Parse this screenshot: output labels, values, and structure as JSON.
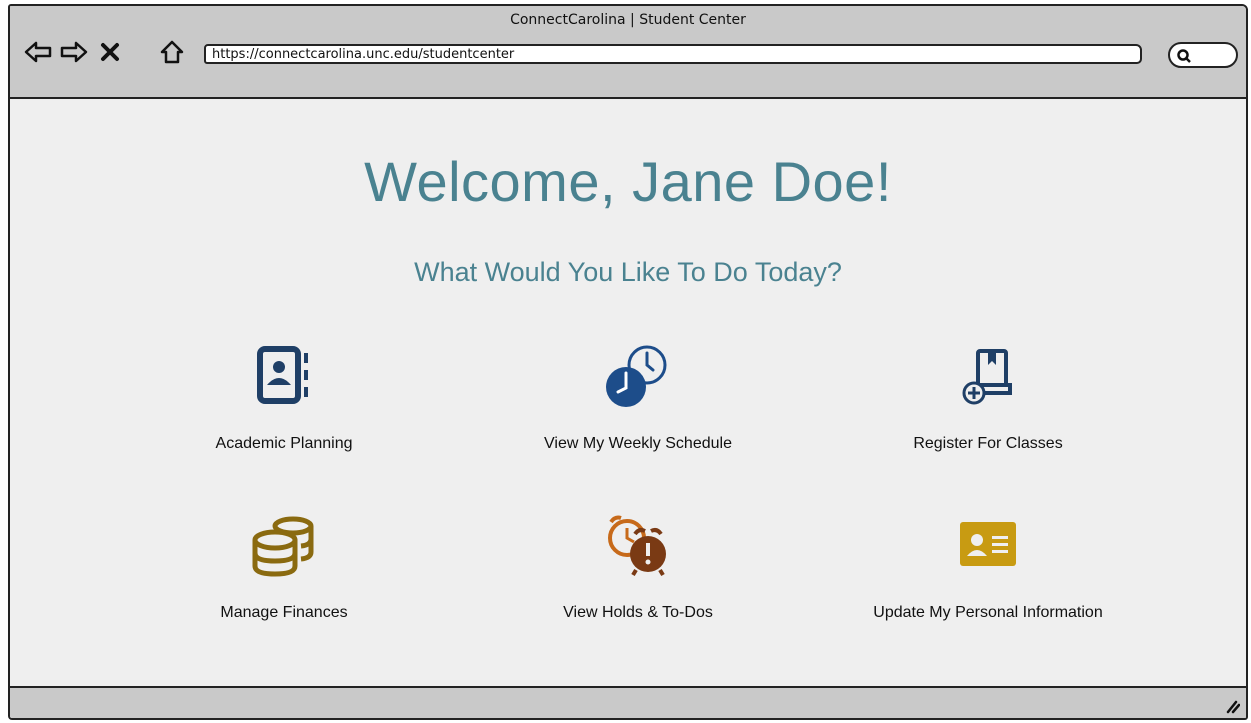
{
  "window": {
    "title": "ConnectCarolina | Student Center"
  },
  "browser": {
    "back_icon": "back-arrow-icon",
    "forward_icon": "forward-arrow-icon",
    "stop_icon": "close-icon",
    "home_icon": "home-icon",
    "url": "https://connectcarolina.unc.edu/studentcenter",
    "search_icon": "search-icon"
  },
  "page": {
    "welcome": "Welcome, Jane Doe!",
    "subtitle": "What Would You Like To Do Today?"
  },
  "actions": [
    {
      "label": "Academic Planning",
      "icon": "address-book-icon",
      "color": "#1f3f66"
    },
    {
      "label": "View My Weekly Schedule",
      "icon": "clock-icon",
      "color": "#1d4d8a"
    },
    {
      "label": "Register For Classes",
      "icon": "book-add-icon",
      "color": "#1f3f66"
    },
    {
      "label": "Manage Finances",
      "icon": "coins-icon",
      "color": "#8a6a10"
    },
    {
      "label": "View Holds & To-Dos",
      "icon": "alarm-alert-icon",
      "color": "#8a3a10"
    },
    {
      "label": "Update My Personal Information",
      "icon": "id-card-icon",
      "color": "#c89b12"
    }
  ],
  "colors": {
    "heading": "#4a8290",
    "chrome": "#c9c9c9",
    "background": "#efefef"
  }
}
